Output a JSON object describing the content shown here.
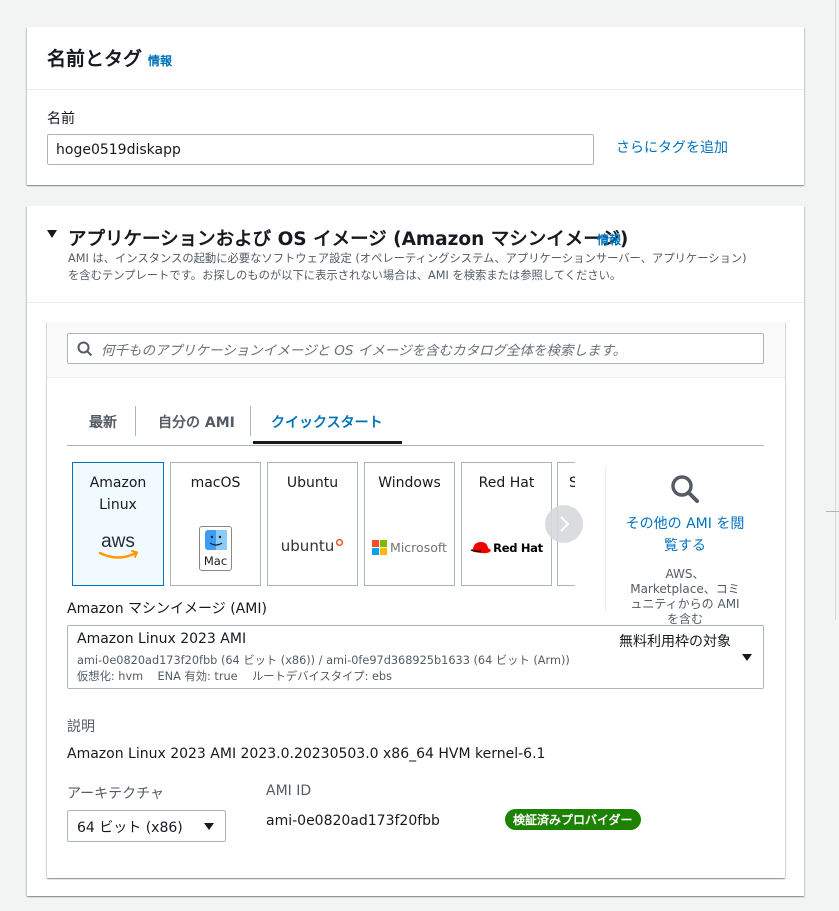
{
  "name_tags": {
    "title": "名前とタグ",
    "info_link": "情報",
    "name_label": "名前",
    "name_value": "hoge0519diskapp",
    "add_tags_link": "さらにタグを追加"
  },
  "ami_section": {
    "title": "アプリケーションおよび OS イメージ (Amazon マシンイメージ)",
    "info_link": "情報",
    "description_line1": "AMI は、インスタンスの起動に必要なソフトウェア設定 (オペレーティングシステム、アプリケーションサーバー、アプリケーション)",
    "description_line2": "を含むテンプレートです。お探しのものが以下に表示されない場合は、AMI を検索または参照してください。",
    "search_placeholder": "何千ものアプリケーションイメージと OS イメージを含むカタログ全体を検索します。",
    "tabs": [
      {
        "label": "最新"
      },
      {
        "label": "自分の AMI"
      },
      {
        "label": "クイックスタート"
      }
    ],
    "active_tab": "クイックスタート",
    "os_tiles": [
      {
        "name": "Amazon Linux",
        "logo_text": "aws",
        "icon": "aws-logo-icon"
      },
      {
        "name": "macOS",
        "logo_text": "Mac",
        "icon": "mac-finder-icon"
      },
      {
        "name": "Ubuntu",
        "logo_text": "ubuntu",
        "icon": "ubuntu-logo-icon"
      },
      {
        "name": "Windows",
        "logo_text": "Microsoft",
        "icon": "microsoft-logo-icon"
      },
      {
        "name": "Red Hat",
        "logo_text": "Red Hat",
        "icon": "redhat-logo-icon"
      },
      {
        "name": "S",
        "logo_text": "",
        "icon": ""
      }
    ],
    "selected_tile": "Amazon Linux",
    "browse_more": {
      "link": "その他の AMI を閲覧する",
      "note": "AWS、Marketplace、コミュニティからの AMI を含む"
    },
    "ami_label": "Amazon マシンイメージ (AMI)",
    "ami_select": {
      "name": "Amazon Linux 2023 AMI",
      "free_tier": "無料利用枠の対象",
      "ids": "ami-0e0820ad173f20fbb (64 ビット (x86)) / ami-0fe97d368925b1633 (64 ビット (Arm))",
      "details": "仮想化: hvm    ENA 有効: true    ルートデバイスタイプ: ebs"
    },
    "description_label": "説明",
    "description_value": "Amazon Linux 2023 AMI 2023.0.20230503.0 x86_64 HVM kernel-6.1",
    "architecture_label": "アーキテクチャ",
    "architecture_value": "64 ビット (x86)",
    "ami_id_label": "AMI ID",
    "ami_id_value": "ami-0e0820ad173f20fbb",
    "verified_badge": "検証済みプロバイダー"
  },
  "colors": {
    "link": "#0073bb",
    "badge_green": "#1d8102",
    "selected_bg": "#f1faff",
    "text": "#16191f"
  }
}
